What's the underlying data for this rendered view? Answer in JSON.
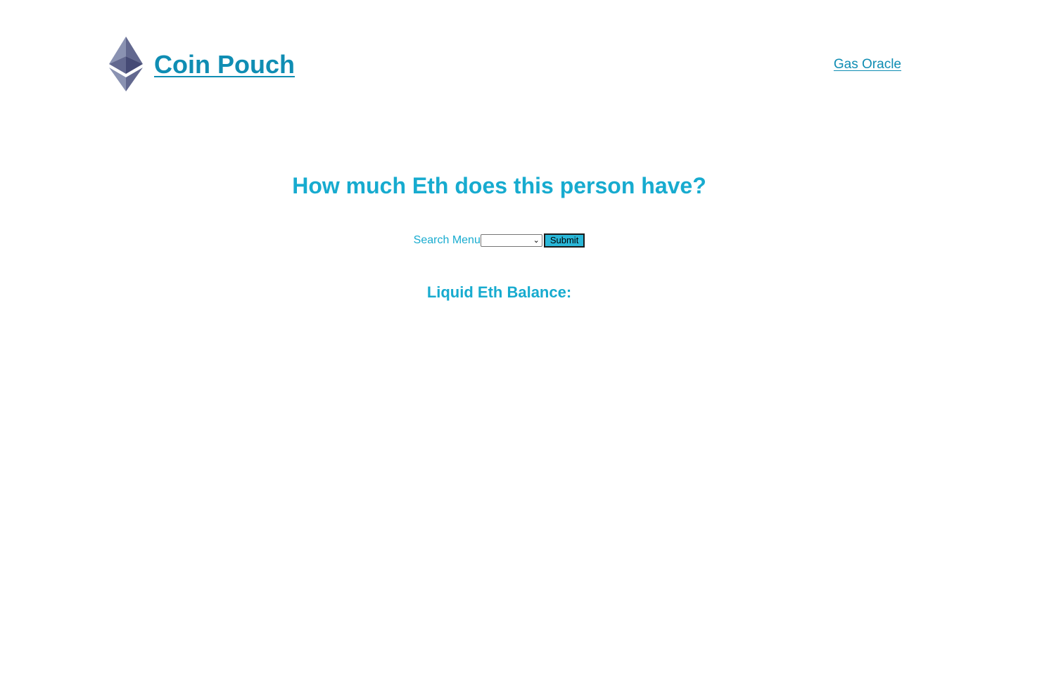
{
  "header": {
    "site_title": "Coin Pouch",
    "logo_icon": "ethereum-logo-icon",
    "nav": {
      "gas_oracle_label": "Gas Oracle"
    }
  },
  "main": {
    "headline": "How much Eth does this person have?",
    "search": {
      "label": "Search Menu",
      "selected_value": "",
      "submit_label": "Submit"
    },
    "balance_label": "Liquid Eth Balance:"
  },
  "colors": {
    "title_link": "#0f8db3",
    "accent": "#17abcf",
    "button_bg": "#2ab7d8"
  }
}
